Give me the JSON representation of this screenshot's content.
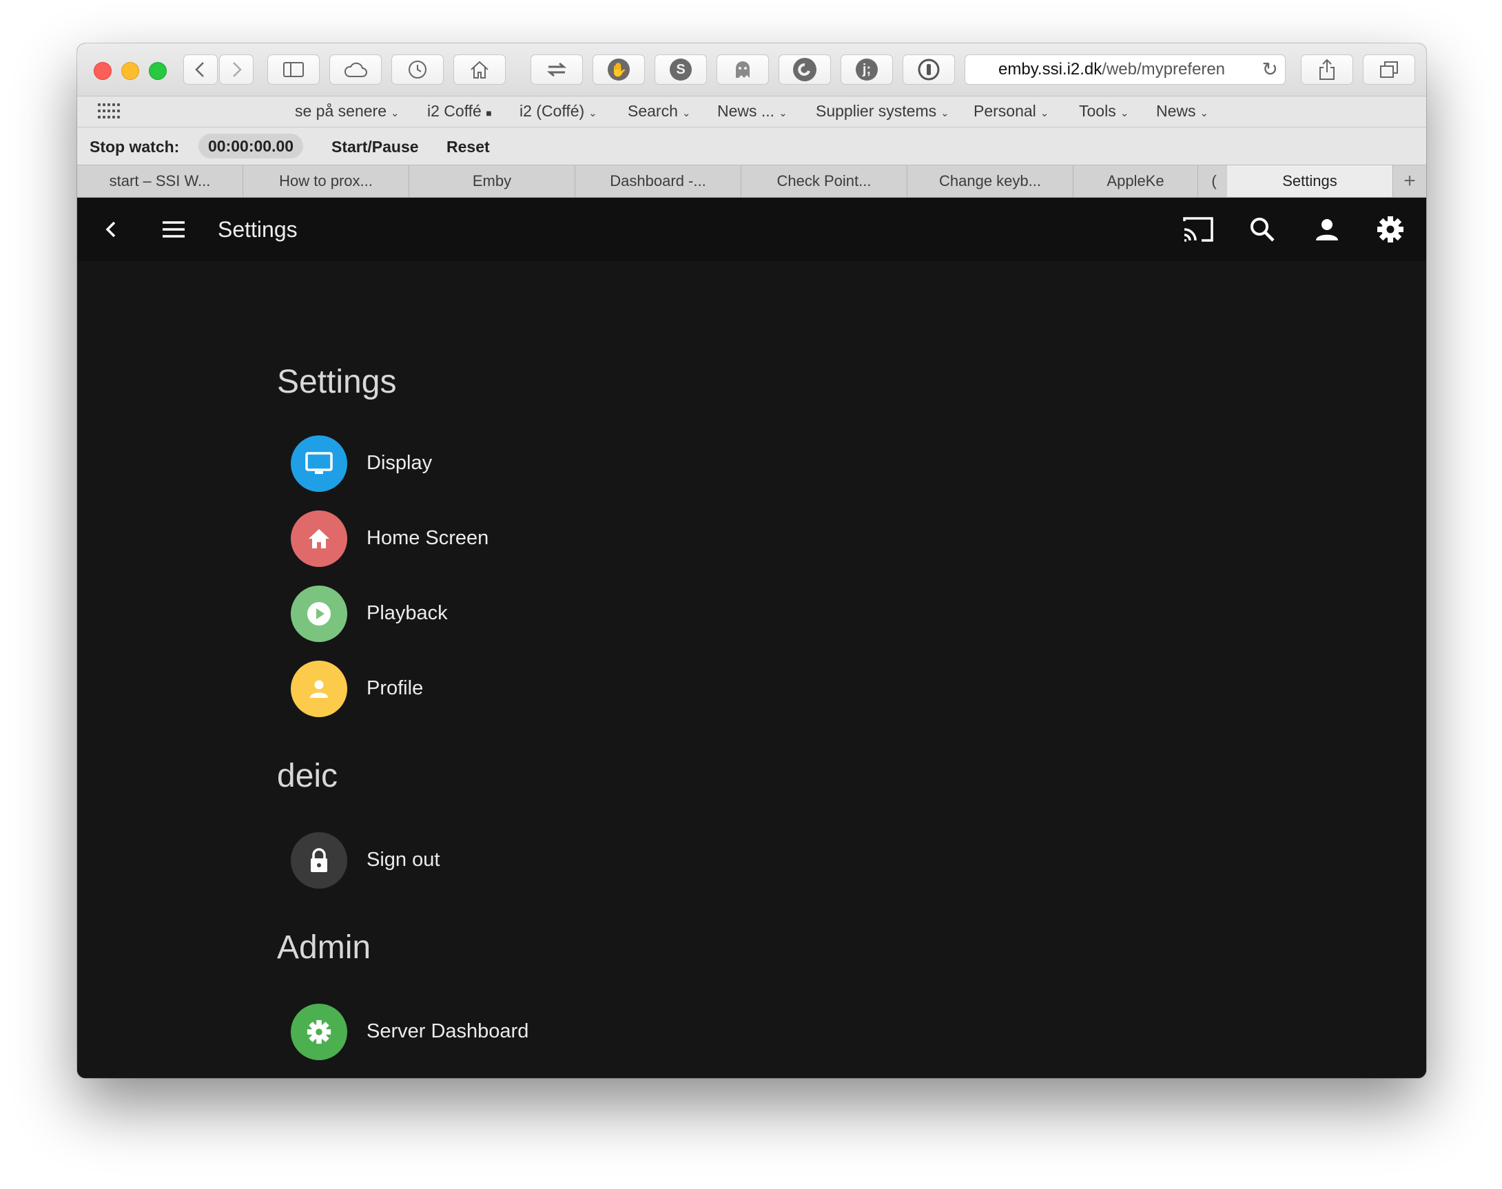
{
  "browser": {
    "url_host": "emby.ssi.i2.dk",
    "url_path": "/web/mypreferen",
    "favorites": [
      {
        "label": "se på senere",
        "has_menu": true
      },
      {
        "label": "i2 Coffé",
        "has_menu": false,
        "marker": "■"
      },
      {
        "label": "i2 (Coffé)",
        "has_menu": true
      },
      {
        "label": "Search",
        "has_menu": true
      },
      {
        "label": "News ...",
        "has_menu": true
      },
      {
        "label": "Supplier systems",
        "has_menu": true
      },
      {
        "label": "Personal",
        "has_menu": true
      },
      {
        "label": "Tools",
        "has_menu": true
      },
      {
        "label": "News",
        "has_menu": true
      }
    ],
    "stopwatch": {
      "label": "Stop watch:",
      "time": "00:00:00.00",
      "start_pause": "Start/Pause",
      "reset": "Reset"
    },
    "tabs": [
      {
        "title": "start – SSI W..."
      },
      {
        "title": "How to prox..."
      },
      {
        "title": "Emby"
      },
      {
        "title": "Dashboard -..."
      },
      {
        "title": "Check Point..."
      },
      {
        "title": "Change keyb..."
      },
      {
        "title": "AppleKe"
      },
      {
        "title": "("
      },
      {
        "title": "Settings",
        "active": true
      },
      {
        "title": "+"
      }
    ]
  },
  "app": {
    "header_title": "Settings",
    "header_icons": [
      "cast-icon",
      "search-icon",
      "user-icon",
      "settings-gear-icon"
    ],
    "sections": [
      {
        "title": "Settings",
        "items": [
          {
            "label": "Display",
            "icon": "monitor-icon",
            "color": "#1fa0e6"
          },
          {
            "label": "Home Screen",
            "icon": "home-icon",
            "color": "#e06a6a"
          },
          {
            "label": "Playback",
            "icon": "play-icon",
            "color": "#7bc47f"
          },
          {
            "label": "Profile",
            "icon": "person-icon",
            "color": "#fccb4b"
          }
        ]
      },
      {
        "title": "deic",
        "items": [
          {
            "label": "Sign out",
            "icon": "lock-icon",
            "color": "#3a3a3a"
          }
        ]
      },
      {
        "title": "Admin",
        "items": [
          {
            "label": "Server Dashboard",
            "icon": "gear-icon",
            "color": "#4caf50"
          }
        ]
      }
    ]
  }
}
